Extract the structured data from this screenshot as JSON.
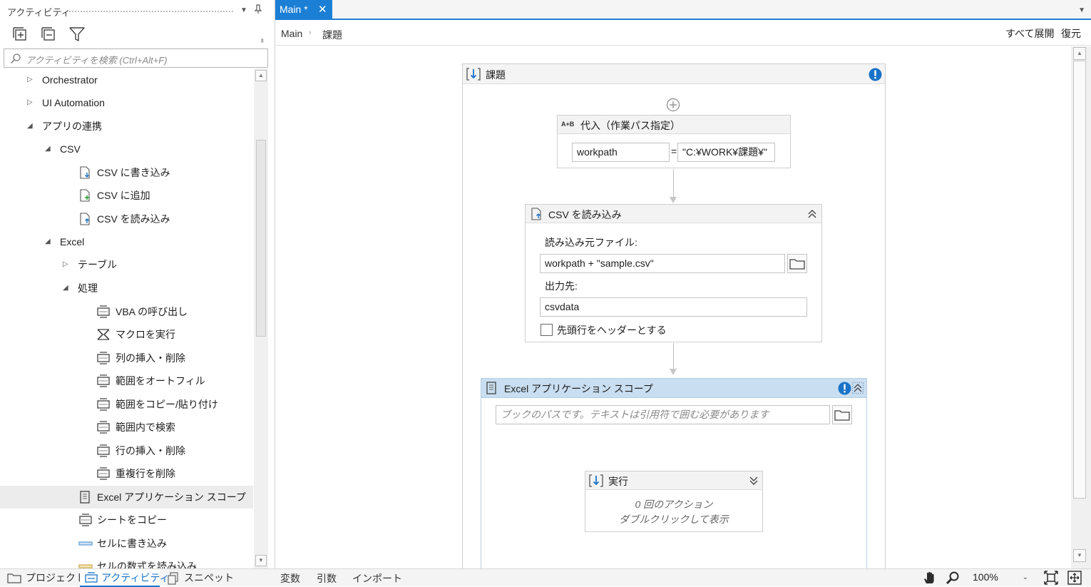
{
  "left_panel": {
    "title": "アクティビティ",
    "search_placeholder": "アクティビティを検索 (Ctrl+Alt+F)",
    "tree": [
      {
        "label": "Orchestrator",
        "arrow": "▷"
      },
      {
        "label": "UI Automation",
        "arrow": "▷"
      },
      {
        "label": "アプリの連携",
        "arrow": "◢"
      },
      {
        "label": "CSV",
        "arrow": "◢"
      },
      {
        "label": "CSV に書き込み"
      },
      {
        "label": "CSV に追加"
      },
      {
        "label": "CSV を読み込み"
      },
      {
        "label": "Excel",
        "arrow": "◢"
      },
      {
        "label": "テーブル",
        "arrow": "▷"
      },
      {
        "label": "処理",
        "arrow": "◢"
      },
      {
        "label": "VBA の呼び出し"
      },
      {
        "label": "マクロを実行"
      },
      {
        "label": "列の挿入・削除"
      },
      {
        "label": "範囲をオートフィル"
      },
      {
        "label": "範囲をコピー/貼り付け"
      },
      {
        "label": "範囲内で検索"
      },
      {
        "label": "行の挿入・削除"
      },
      {
        "label": "重複行を削除"
      },
      {
        "label": "Excel アプリケーション スコープ"
      },
      {
        "label": "シートをコピー"
      },
      {
        "label": "セルに書き込み"
      },
      {
        "label": "セルの数式を読み込み"
      }
    ],
    "bottom_tabs": [
      {
        "label": "プロジェクト"
      },
      {
        "label": "アクティビティ"
      },
      {
        "label": "スニペット"
      }
    ]
  },
  "designer": {
    "tab_title": "Main *",
    "tab_close": "✕",
    "breadcrumb": [
      "Main",
      "課題"
    ],
    "breadcrumb_sep": "›",
    "expand_all": "すべて展開",
    "restore": "復元",
    "sequence": {
      "title": "課題"
    },
    "assign": {
      "title": "代入（作業パス指定）",
      "icon_text": "A+B",
      "left_value": "workpath",
      "operator": "=",
      "right_value": "\"C:¥WORK¥課題¥\""
    },
    "read_csv": {
      "title": "CSV を読み込み",
      "source_label": "読み込み元ファイル:",
      "source_value": "workpath + \"sample.csv\"",
      "output_label": "出力先:",
      "output_value": "csvdata",
      "header_checkbox_label": "先頭行をヘッダーとする",
      "header_checked": false
    },
    "excel_scope": {
      "title": "Excel アプリケーション スコープ",
      "path_placeholder": "ブックのパスです。テキストは引用符で囲む必要があります",
      "do": {
        "title": "実行",
        "line1": "0 回のアクション",
        "line2": "ダブルクリックして表示"
      }
    }
  },
  "status_bar": {
    "variables": "変数",
    "arguments": "引数",
    "imports": "インポート",
    "zoom": "100%"
  },
  "colors": {
    "accent": "#1c7fd6",
    "selected_activity_header": "#c9def0",
    "warning": "#1a73c8"
  }
}
